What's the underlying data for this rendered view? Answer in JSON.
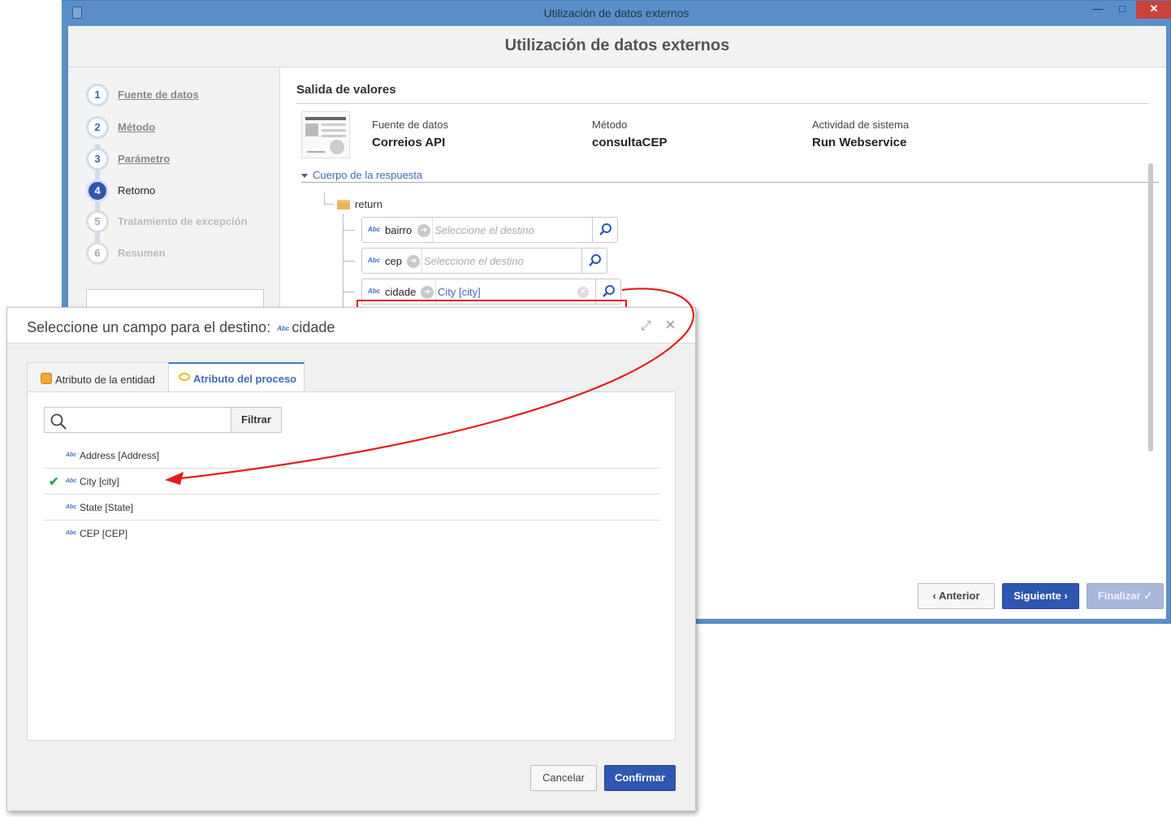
{
  "window": {
    "title": "Utilización de datos externos",
    "header": "Utilización de datos externos",
    "min_glyph": "—",
    "max_glyph": "□",
    "close_glyph": "✕"
  },
  "steps": [
    {
      "num": "1",
      "label": "Fuente de datos",
      "state": "done"
    },
    {
      "num": "2",
      "label": "Método",
      "state": "done"
    },
    {
      "num": "3",
      "label": "Parámetro",
      "state": "done"
    },
    {
      "num": "4",
      "label": "Retorno",
      "state": "active"
    },
    {
      "num": "5",
      "label": "Tratamiento de excepción",
      "state": "future"
    },
    {
      "num": "6",
      "label": "Resumen",
      "state": "future"
    }
  ],
  "section": {
    "title": "Salida de valores",
    "info": [
      {
        "key": "Fuente de datos",
        "value": "Correios API"
      },
      {
        "key": "Método",
        "value": "consultaCEP"
      },
      {
        "key": "Actividad de sistema",
        "value": "Run Webservice"
      }
    ],
    "body_toggle": "Cuerpo de la respuesta",
    "return_label": "return"
  },
  "fields": [
    {
      "type_badge": "Abc",
      "name": "bairro",
      "placeholder": "Seleccione el destino",
      "value": ""
    },
    {
      "type_badge": "Abc",
      "name": "cep",
      "placeholder": "Seleccione el destino",
      "value": ""
    },
    {
      "type_badge": "Abc",
      "name": "cidade",
      "placeholder": "",
      "value": "City [city]"
    }
  ],
  "nav": {
    "prev": "Anterior",
    "next": "Siguiente",
    "finish": "Finalizar"
  },
  "dialog": {
    "title": "Seleccione un campo para el destino:",
    "type_badge": "Abc",
    "field_name": "cidade",
    "tabs": [
      {
        "label": "Atributo de la entidad",
        "active": false
      },
      {
        "label": "Atributo del proceso",
        "active": true
      }
    ],
    "search_placeholder": "",
    "filter_label": "Filtrar",
    "items": [
      {
        "type_badge": "Abc",
        "label": "Address [Address]",
        "selected": false
      },
      {
        "type_badge": "Abc",
        "label": "City [city]",
        "selected": true
      },
      {
        "type_badge": "Abc",
        "label": "State [State]",
        "selected": false
      },
      {
        "type_badge": "Abc",
        "label": "CEP [CEP]",
        "selected": false
      }
    ],
    "cancel_label": "Cancelar",
    "confirm_label": "Confirmar"
  },
  "colors": {
    "window_frame": "#5b8fc9",
    "primary": "#2f56b0",
    "link": "#3f6ab7",
    "annotation": "#e31b1b",
    "check": "#33a05a"
  }
}
